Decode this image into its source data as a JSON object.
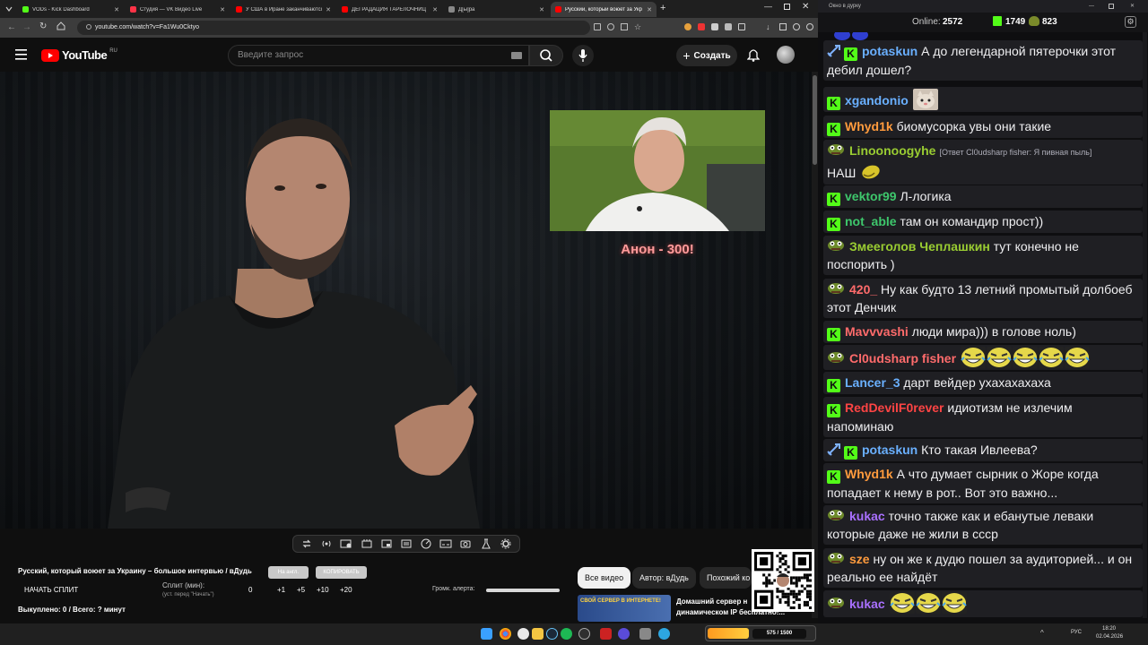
{
  "browser": {
    "tabs": [
      {
        "title": "VODs - Kick Dashboard",
        "color": "#53fc18",
        "active": false
      },
      {
        "title": "Студия — VK Видео Live",
        "color": "#ff3347",
        "active": false
      },
      {
        "title": "У США в Иране заканчиваются",
        "color": "#ff0000",
        "active": false
      },
      {
        "title": "ДЕГРАДАЦИЯ ТАРЕЛОЧНИЦ",
        "color": "#ff0000",
        "active": false
      },
      {
        "title": "Д[ы]ра",
        "color": "#888888",
        "active": false
      },
      {
        "title": "Русский, который воюет за Укр",
        "color": "#ff0000",
        "active": true
      }
    ],
    "url": "youtube.com/watch?v=Fa1Wu0Cktyo"
  },
  "youtube": {
    "logo_text": "YouTube",
    "region": "RU",
    "search_placeholder": "Введите запрос",
    "create_label": "Создать",
    "video": {
      "caption": "Анон - 300!",
      "title": "Русский, который воюет за Украину – большое интервью / вДудь",
      "copy_btn_1": "На англ.",
      "copy_btn_2": "КОПИРОВАТЬ"
    },
    "chips": [
      "Все видео",
      "Автор: вДудь",
      "Похожий ко"
    ],
    "recommended": {
      "thumb_text": "СВОЙ СЕРВЕР В ИНТЕРНЕТЕ!",
      "title_line1": "Домашний сервер н",
      "title_line2": "динамическом IP бесплатно!..."
    }
  },
  "split_panel": {
    "start_label": "НАЧАТЬ СПЛИТ",
    "split_label": "Сплит (мин):",
    "split_hint": "(уст. перед \"Начать\")",
    "values": [
      "0",
      "+1",
      "+5",
      "+10",
      "+20"
    ],
    "volume_label": "Громк. алерта:",
    "volume_level": 1.0,
    "bought_label": "Выкуплено: 0 / Всего: ? минут"
  },
  "chat": {
    "window_title": "Окно в дурку",
    "online_label": "Online:",
    "online_value": "2572",
    "count_a": "1749",
    "count_b": "823",
    "messages": [
      {
        "badges": [
          "sword",
          "k"
        ],
        "name": "potaskun",
        "color": "#6ab0ff",
        "text": "А до легендарной пятерочки этот дебил дошел?",
        "emotes": 0
      },
      {
        "badges": [
          "k"
        ],
        "name": "xgandonio",
        "color": "#6ab0ff",
        "text": "",
        "emotes": 1,
        "emote_kind": "cat"
      },
      {
        "badges": [
          "k"
        ],
        "name": "Whyd1k",
        "color": "#ff9b3d",
        "text": "биомусорка увы они такие",
        "emotes": 0
      },
      {
        "badges": [
          "pepe"
        ],
        "name": "Linoonoogyhe",
        "color": "#9acd32",
        "reply": "[Ответ Cl0udsharp fisher: Я пивная пыль]",
        "text": "НАШ",
        "emotes": 1,
        "emote_kind": "yellow"
      },
      {
        "badges": [
          "k"
        ],
        "name": "vektor99",
        "color": "#3ec76c",
        "text": "Л-логика",
        "emotes": 0
      },
      {
        "badges": [
          "k"
        ],
        "name": "not_able",
        "color": "#3ec76c",
        "text": "там он командир прост))",
        "emotes": 0
      },
      {
        "badges": [
          "pepe"
        ],
        "name": "Змееголов Чеплашкин",
        "color": "#9acd32",
        "text": "тут конечно не поспорить )",
        "emotes": 0
      },
      {
        "badges": [
          "pepe"
        ],
        "name": "420_",
        "color": "#ff6b6b",
        "text": "Ну как будто 13 летний промытый долбоеб этот Денчик",
        "emotes": 0
      },
      {
        "badges": [
          "k"
        ],
        "name": "Mavvvashi",
        "color": "#ff6b6b",
        "text": "люди мира))) в голове ноль)",
        "emotes": 0
      },
      {
        "badges": [
          "pepe"
        ],
        "name": "Cl0udsharp fisher",
        "color": "#ff6b6b",
        "text": "",
        "emotes": 5,
        "emote_kind": "laugh"
      },
      {
        "badges": [
          "k"
        ],
        "name": "Lancer_3",
        "color": "#6ab0ff",
        "text": "дарт вейдер ухахахахаха",
        "emotes": 0
      },
      {
        "badges": [
          "k"
        ],
        "name": "RedDevilF0rever",
        "color": "#ff4444",
        "text": "идиотизм не излечим напоминаю",
        "emotes": 0
      },
      {
        "badges": [
          "sword",
          "k"
        ],
        "name": "potaskun",
        "color": "#6ab0ff",
        "text": "Кто такая Ивлеева?",
        "emotes": 0
      },
      {
        "badges": [
          "k"
        ],
        "name": "Whyd1k",
        "color": "#ff9b3d",
        "text": "А что думает сырник о Жоре когда попадает к нему в рот.. Вот это важно...",
        "emotes": 0
      },
      {
        "badges": [
          "pepe"
        ],
        "name": "kukac",
        "color": "#a970ff",
        "text": "точно также как и ебанутые леваки которые даже не жили в ссср",
        "emotes": 0
      },
      {
        "badges": [
          "pepe"
        ],
        "name": "sze",
        "color": "#ff9b3d",
        "text": "ну он же к дудю пошел за аудиторией... и он реально ее найдёт",
        "emotes": 0
      },
      {
        "badges": [
          "pepe"
        ],
        "name": "kukac",
        "color": "#a970ff",
        "text": "",
        "emotes": 3,
        "emote_kind": "laugh"
      }
    ]
  },
  "taskbar": {
    "counter": "575 / 1500",
    "lang": "РУС",
    "time": "18:20",
    "date": "02.04.2026"
  },
  "colors": {
    "yt_red": "#ff0000",
    "kick_green": "#53fc18",
    "chat_bg": "#0e0e10",
    "msg_bg": "#1f1f23"
  }
}
